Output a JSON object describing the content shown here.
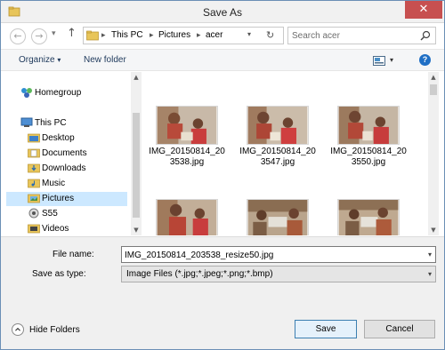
{
  "window": {
    "title": "Save As",
    "close_symbol": "✕"
  },
  "navigation": {
    "back_symbol": "←",
    "forward_symbol": "→",
    "recent_symbol": "▾",
    "up_symbol": "↑",
    "breadcrumb": [
      "This PC",
      "Pictures",
      "acer"
    ],
    "breadcrumb_separator": "▸",
    "dropdown_symbol": "▾",
    "refresh_symbol": "↻",
    "search_placeholder": "Search acer"
  },
  "toolbar": {
    "organize_label": "Organize",
    "organize_arrow": "▾",
    "new_folder_label": "New folder",
    "view_arrow": "▾",
    "help_symbol": "?"
  },
  "sidebar": {
    "items": [
      {
        "label": "Homegroup",
        "icon": "homegroup-icon"
      },
      {
        "label": "This PC",
        "icon": "computer-icon"
      },
      {
        "label": "Desktop",
        "icon": "folder-icon"
      },
      {
        "label": "Documents",
        "icon": "folder-icon"
      },
      {
        "label": "Downloads",
        "icon": "folder-icon"
      },
      {
        "label": "Music",
        "icon": "folder-icon"
      },
      {
        "label": "Pictures",
        "icon": "folder-icon"
      },
      {
        "label": "S55",
        "icon": "device-icon"
      },
      {
        "label": "Videos",
        "icon": "folder-icon"
      }
    ],
    "selected": "Pictures"
  },
  "files": [
    {
      "name_line1": "IMG_20150814_20",
      "name_line2": "3538.jpg"
    },
    {
      "name_line1": "IMG_20150814_20",
      "name_line2": "3547.jpg"
    },
    {
      "name_line1": "IMG_20150814_20",
      "name_line2": "3550.jpg"
    },
    {
      "name_line1": "",
      "name_line2": ""
    },
    {
      "name_line1": "",
      "name_line2": ""
    },
    {
      "name_line1": "",
      "name_line2": ""
    }
  ],
  "form": {
    "file_name_label": "File name:",
    "file_name_value": "IMG_20150814_203538_resize50.jpg",
    "save_type_label": "Save as type:",
    "save_type_value": "Image Files  (*.jpg;*.jpeg;*.png;*.bmp)",
    "dropdown_symbol": "▾"
  },
  "footer": {
    "hide_folders_label": "Hide Folders",
    "save_label": "Save",
    "cancel_label": "Cancel"
  },
  "colors": {
    "accent": "#3c7fb1",
    "close": "#c75050",
    "selection": "#cce8ff"
  }
}
